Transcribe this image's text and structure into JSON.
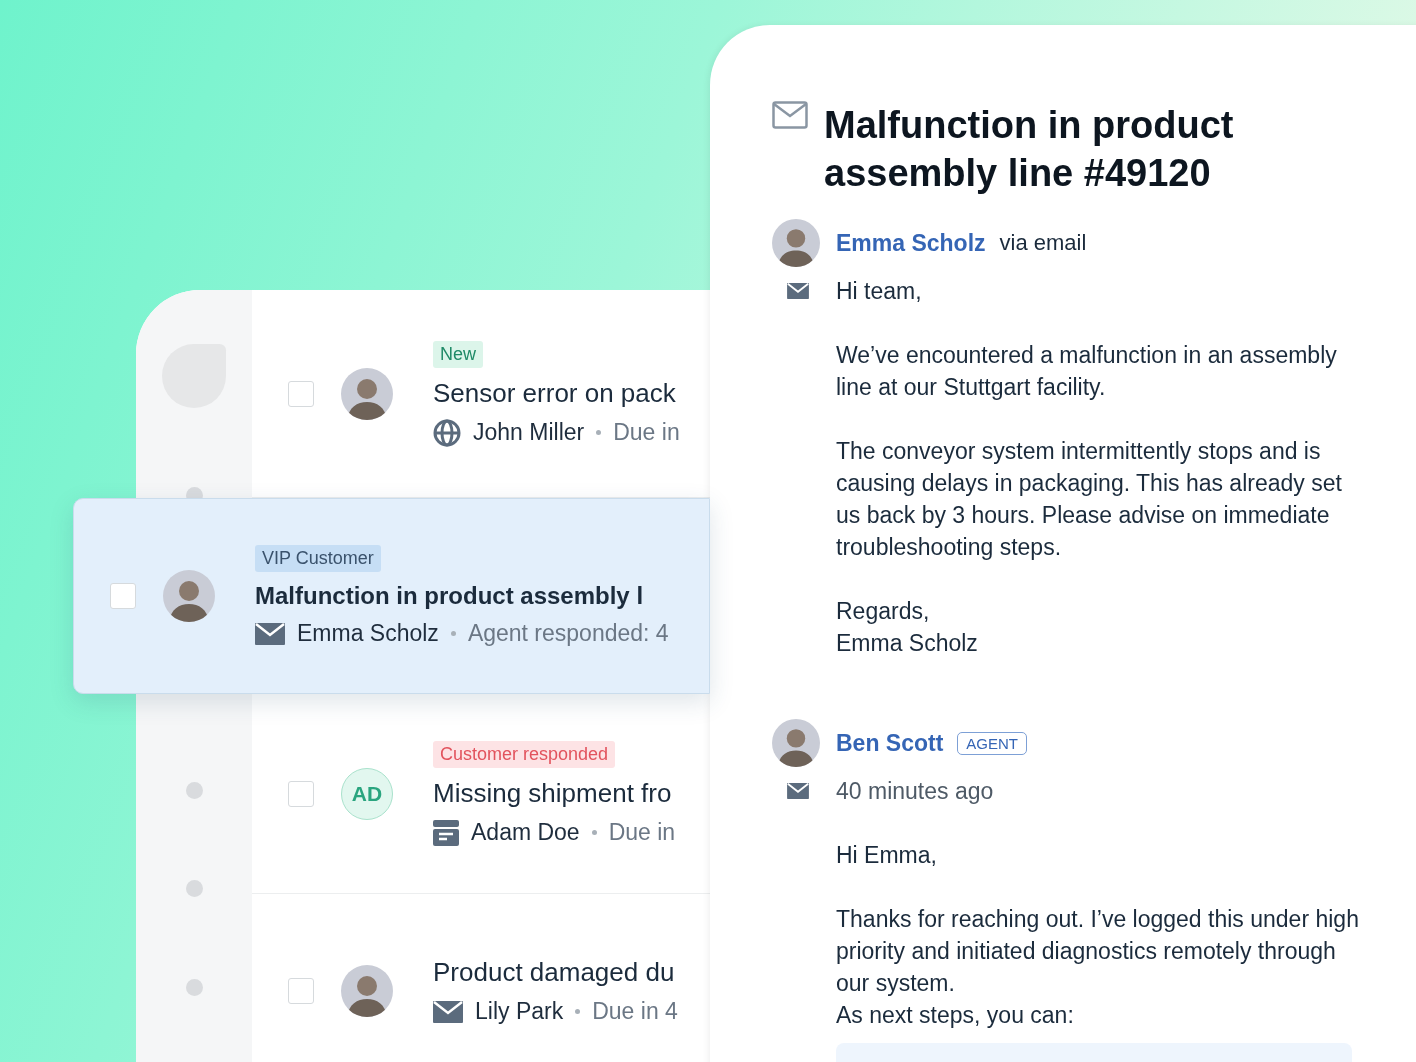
{
  "tickets": [
    {
      "tag": {
        "kind": "new",
        "label": "New"
      },
      "avatar": {
        "kind": "photo"
      },
      "title": "Sensor error on pack",
      "icon": {
        "kind": "globe"
      },
      "name": "John Miller",
      "meta": "Due in",
      "checked": false,
      "selected": false
    },
    {
      "tag": {
        "kind": "vip",
        "label": "VIP Customer"
      },
      "avatar": {
        "kind": "photo"
      },
      "title": "Malfunction in product assembly l",
      "icon": {
        "kind": "mail"
      },
      "name": "Emma Scholz",
      "meta": "Agent responded: 4",
      "checked": false,
      "selected": true
    },
    {
      "tag": {
        "kind": "responded",
        "label": "Customer responded"
      },
      "avatar": {
        "kind": "initials",
        "initials": "AD"
      },
      "title": "Missing shipment fro",
      "icon": {
        "kind": "archive"
      },
      "name": "Adam Doe",
      "meta": "Due in",
      "checked": false,
      "selected": false
    },
    {
      "avatar": {
        "kind": "photo"
      },
      "title": "Product damaged du",
      "icon": {
        "kind": "mail"
      },
      "name": "Lily Park",
      "meta": "Due in 4",
      "checked": false,
      "selected": false
    }
  ],
  "detail": {
    "title": "Malfunction in product assembly line #49120",
    "messages": [
      {
        "author": "Emma Scholz",
        "via": "via email",
        "blocks": [
          [
            "Hi team,"
          ],
          [
            "We’ve encountered a malfunction in an assembly line at our Stuttgart facility."
          ],
          [
            "The conveyor system intermittently stops and is causing delays in packaging. This has already set us back by 3 hours. Please advise on immediate troubleshooting steps."
          ],
          [
            "Regards,",
            "Emma Scholz"
          ]
        ]
      },
      {
        "author": "Ben Scott",
        "badge": "AGENT",
        "time": "40 minutes ago",
        "blocks": [
          [
            "Hi Emma,"
          ],
          [
            "Thanks for reaching out. I’ve logged this under high priority and initiated diagnostics remotely through our system.",
            "As next steps, you can:"
          ]
        ]
      }
    ]
  }
}
